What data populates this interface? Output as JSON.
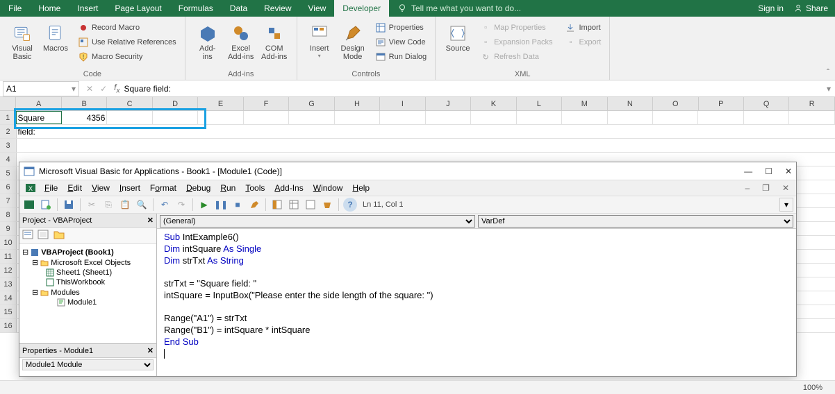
{
  "ribbon": {
    "tabs": [
      "File",
      "Home",
      "Insert",
      "Page Layout",
      "Formulas",
      "Data",
      "Review",
      "View",
      "Developer"
    ],
    "active_tab": "Developer",
    "tell_me": "Tell me what you want to do...",
    "sign_in": "Sign in",
    "share": "Share",
    "groups": {
      "code": {
        "label": "Code",
        "visual_basic": "Visual\nBasic",
        "macros": "Macros",
        "record": "Record Macro",
        "relative": "Use Relative References",
        "security": "Macro Security"
      },
      "addins": {
        "label": "Add-ins",
        "addins": "Add-\nins",
        "excel": "Excel\nAdd-ins",
        "com": "COM\nAdd-ins"
      },
      "controls": {
        "label": "Controls",
        "insert": "Insert",
        "design": "Design\nMode",
        "properties": "Properties",
        "view_code": "View Code",
        "run_dialog": "Run Dialog"
      },
      "xml": {
        "label": "XML",
        "source": "Source",
        "map": "Map Properties",
        "expansion": "Expansion Packs",
        "refresh": "Refresh Data",
        "import": "Import",
        "export": "Export"
      }
    }
  },
  "fx": {
    "name": "A1",
    "formula": "Square field:"
  },
  "grid": {
    "cols": [
      "A",
      "B",
      "C",
      "D",
      "E",
      "F",
      "G",
      "H",
      "I",
      "J",
      "K",
      "L",
      "M",
      "N",
      "O",
      "P",
      "Q",
      "R"
    ],
    "a1": "Square field:",
    "b1": "4356"
  },
  "vbe": {
    "title": "Microsoft Visual Basic for Applications - Book1 - [Module1 (Code)]",
    "menu": {
      "file": "File",
      "edit": "Edit",
      "view": "View",
      "insert": "Insert",
      "format": "Format",
      "debug": "Debug",
      "run": "Run",
      "tools": "Tools",
      "addins": "Add-Ins",
      "window": "Window",
      "help": "Help"
    },
    "pos": "Ln 11, Col 1",
    "project_title": "Project - VBAProject",
    "tree": {
      "root": "VBAProject (Book1)",
      "objects": "Microsoft Excel Objects",
      "sheet1": "Sheet1 (Sheet1)",
      "thiswb": "ThisWorkbook",
      "modules": "Modules",
      "mod1": "Module1"
    },
    "props_title": "Properties - Module1",
    "props_value": "Module1 Module",
    "dd_left": "(General)",
    "dd_right": "VarDef",
    "code": {
      "l1a": "Sub",
      "l1b": " IntExample6()",
      "l2a": "Dim",
      "l2b": " intSquare ",
      "l2c": "As Single",
      "l3a": "Dim",
      "l3b": " strTxt ",
      "l3c": "As String",
      "l5": "strTxt = \"Square field: \"",
      "l6": "intSquare = InputBox(\"Please enter the side length of the square: \")",
      "l8": "Range(\"A1\") = strTxt",
      "l9": "Range(\"B1\") = intSquare * intSquare",
      "l10": "End Sub"
    }
  },
  "status": {
    "zoom": "100%"
  }
}
